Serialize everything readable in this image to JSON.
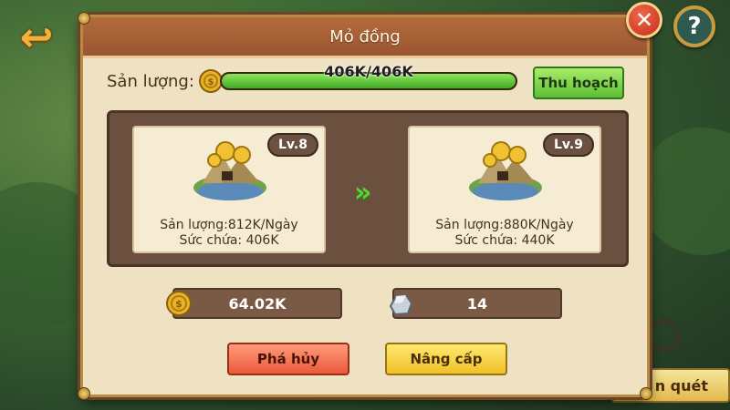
{
  "dialog": {
    "title": "Mỏ đồng",
    "close_icon": "close-icon"
  },
  "production": {
    "label": "Sản lượng:",
    "current_text": "406K/406K",
    "fill_fraction": 1.0,
    "harvest_button": "Thu hoạch"
  },
  "current_level": {
    "level": "Lv.8",
    "production_text": "Sản lượng:812K/Ngày",
    "capacity_text": "Sức chứa: 406K"
  },
  "next_level": {
    "level": "Lv.9",
    "production_text": "Sản lượng:880K/Ngày",
    "capacity_text": "Sức chứa: 440K"
  },
  "cost": {
    "coin_amount": "64.02K",
    "stone_amount": "14"
  },
  "actions": {
    "destroy_button": "Phá hủy",
    "upgrade_button": "Nâng cấp"
  },
  "background": {
    "help_icon": "?",
    "scan_button_partial": "n quét"
  },
  "colors": {
    "title_bar": "#9a5630",
    "progress_green": "#3faa24",
    "harvest_green": "#5dbd36",
    "destroy_red": "#ea5a3a",
    "upgrade_yellow": "#f0c128"
  }
}
